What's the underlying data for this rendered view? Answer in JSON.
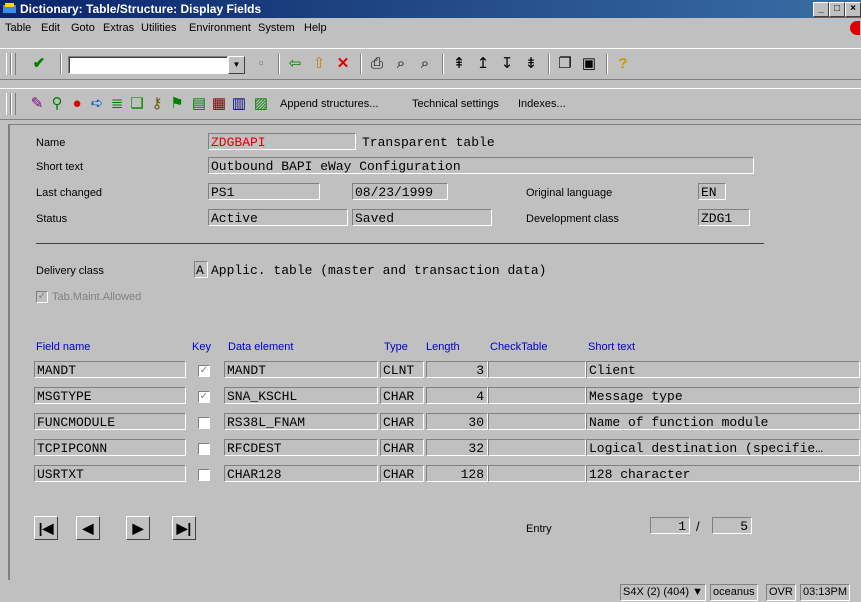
{
  "window": {
    "title": "Dictionary: Table/Structure: Display Fields"
  },
  "menu": [
    "Table",
    "Edit",
    "Goto",
    "Extras",
    "Utilities",
    "Environment",
    "System",
    "Help"
  ],
  "app_toolbar": {
    "append_structures": "Append structures...",
    "technical_settings": "Technical settings",
    "indexes": "Indexes..."
  },
  "header": {
    "name_label": "Name",
    "name_value": "ZDGBAPI",
    "table_type": "Transparent table",
    "short_text_label": "Short text",
    "short_text_value": "Outbound BAPI eWay Configuration",
    "last_changed_label": "Last changed",
    "last_changed_user": "PS1",
    "last_changed_date": "08/23/1999",
    "original_language_label": "Original language",
    "original_language_value": "EN",
    "status_label": "Status",
    "status_value": "Active",
    "status_saved": "Saved",
    "dev_class_label": "Development class",
    "dev_class_value": "ZDG1",
    "delivery_class_label": "Delivery class",
    "delivery_class_value": "A",
    "delivery_class_text": "Applic. table (master and transaction data)",
    "tab_maint_label": "Tab.Maint.Allowed"
  },
  "table": {
    "columns": [
      "Field name",
      "Key",
      "Data element",
      "Type",
      "Length",
      "CheckTable",
      "Short text"
    ],
    "rows": [
      {
        "field": "MANDT",
        "key": true,
        "element": "MANDT",
        "type": "CLNT",
        "length": "3",
        "check": "",
        "text": "Client"
      },
      {
        "field": "MSGTYPE",
        "key": true,
        "element": "SNA_KSCHL",
        "type": "CHAR",
        "length": "4",
        "check": "",
        "text": "Message type"
      },
      {
        "field": "FUNCMODULE",
        "key": false,
        "element": "RS38L_FNAM",
        "type": "CHAR",
        "length": "30",
        "check": "",
        "text": "Name of function module"
      },
      {
        "field": "TCPIPCONN",
        "key": false,
        "element": "RFCDEST",
        "type": "CHAR",
        "length": "32",
        "check": "",
        "text": "Logical destination (specifie…"
      },
      {
        "field": "USRTXT",
        "key": false,
        "element": "CHAR128",
        "type": "CHAR",
        "length": "128",
        "check": "",
        "text": "128 character"
      }
    ]
  },
  "entry": {
    "label": "Entry",
    "current": "1",
    "sep": "/",
    "total": "5"
  },
  "statusbar": {
    "system": "S4X (2) (404)",
    "server": "oceanus",
    "mode": "OVR",
    "time": "03:13PM"
  }
}
